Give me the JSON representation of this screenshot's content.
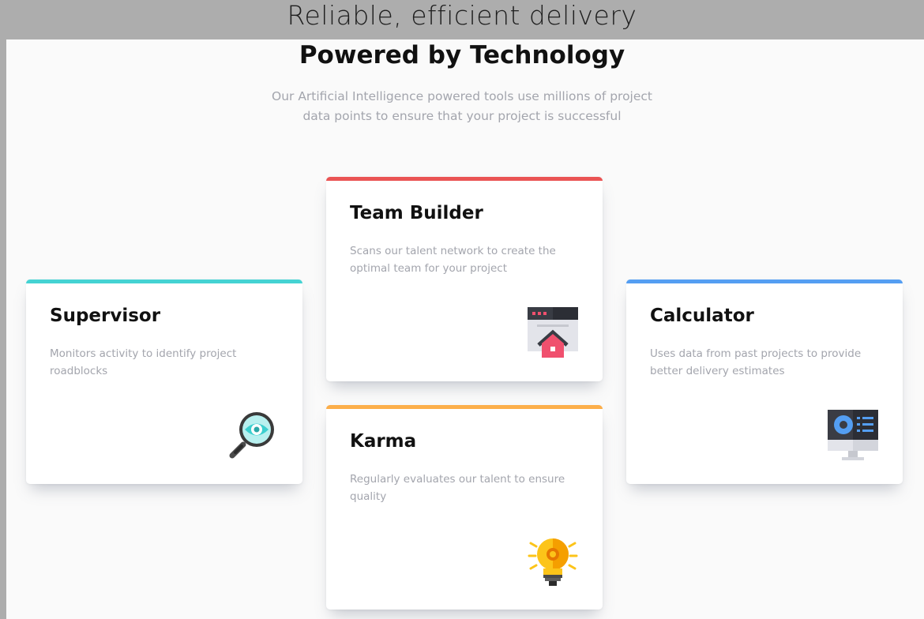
{
  "header": {
    "tagline": "Reliable, efficient delivery",
    "title": "Powered by Technology",
    "description_line1": "Our Artificial Intelligence powered tools use millions of project",
    "description_line2": "data points to ensure that your project is successful"
  },
  "cards": [
    {
      "title": "Supervisor",
      "text": "Monitors activity to identify project roadblocks",
      "accent": "#45d3d3",
      "icon": "magnifier-eye-icon"
    },
    {
      "title": "Team Builder",
      "text": "Scans our talent network to create the optimal team for your project",
      "accent": "#ea5454",
      "icon": "browser-house-icon"
    },
    {
      "title": "Karma",
      "text": "Regularly evaluates our talent to ensure quality",
      "accent": "#fcae4a",
      "icon": "lightbulb-icon"
    },
    {
      "title": "Calculator",
      "text": "Uses data from past projects to provide better delivery estimates",
      "accent": "#549ef2",
      "icon": "monitor-chart-icon"
    }
  ]
}
